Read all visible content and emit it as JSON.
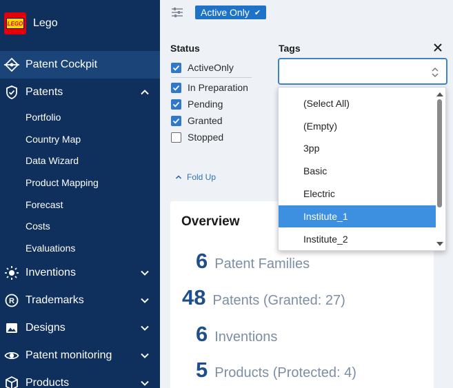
{
  "app": {
    "name": "Lego",
    "logo_text": "LEGO"
  },
  "sidebar": {
    "items": [
      {
        "label": "Patent Cockpit",
        "icon": "cockpit-icon"
      },
      {
        "label": "Patents",
        "icon": "shield-check-icon",
        "children": [
          "Portfolio",
          "Country Map",
          "Data Wizard",
          "Product Mapping",
          "Forecast",
          "Costs",
          "Evaluations"
        ]
      },
      {
        "label": "Inventions",
        "icon": "lightbulb-icon"
      },
      {
        "label": "Trademarks",
        "icon": "registered-icon"
      },
      {
        "label": "Designs",
        "icon": "image-icon"
      },
      {
        "label": "Patent monitoring",
        "icon": "eye-icon"
      },
      {
        "label": "Products",
        "icon": "box-icon"
      }
    ]
  },
  "topbar": {
    "active_filter": "Active Only"
  },
  "filters": {
    "status_title": "Status",
    "status_options": [
      {
        "label": "ActiveOnly",
        "checked": true
      },
      {
        "label": "In Preparation",
        "checked": true
      },
      {
        "label": "Pending",
        "checked": true
      },
      {
        "label": "Granted",
        "checked": true
      },
      {
        "label": "Stopped",
        "checked": false
      }
    ],
    "fold_label": "Fold Up",
    "tags_title": "Tags",
    "tags_value": "",
    "tags_options": [
      "(Select All)",
      "(Empty)",
      "3pp",
      "Basic",
      "Electric",
      "Institute_1",
      "Institute_2"
    ],
    "tags_highlighted": "Institute_1"
  },
  "overview": {
    "title": "Overview",
    "stats": [
      {
        "value": "6",
        "label": "Patent Families"
      },
      {
        "value": "48",
        "label": "Patents (Granted: 27)"
      },
      {
        "value": "6",
        "label": "Inventions"
      },
      {
        "value": "5",
        "label": "Products (Protected: 4)"
      }
    ]
  },
  "colors": {
    "sidebar_bg": "#0f2f5c",
    "sidebar_active": "#1b4578",
    "accent": "#1e73c8",
    "stat_number": "#1e4f8a",
    "stat_label": "#7c8ea3",
    "highlight": "#3d8fe0"
  }
}
